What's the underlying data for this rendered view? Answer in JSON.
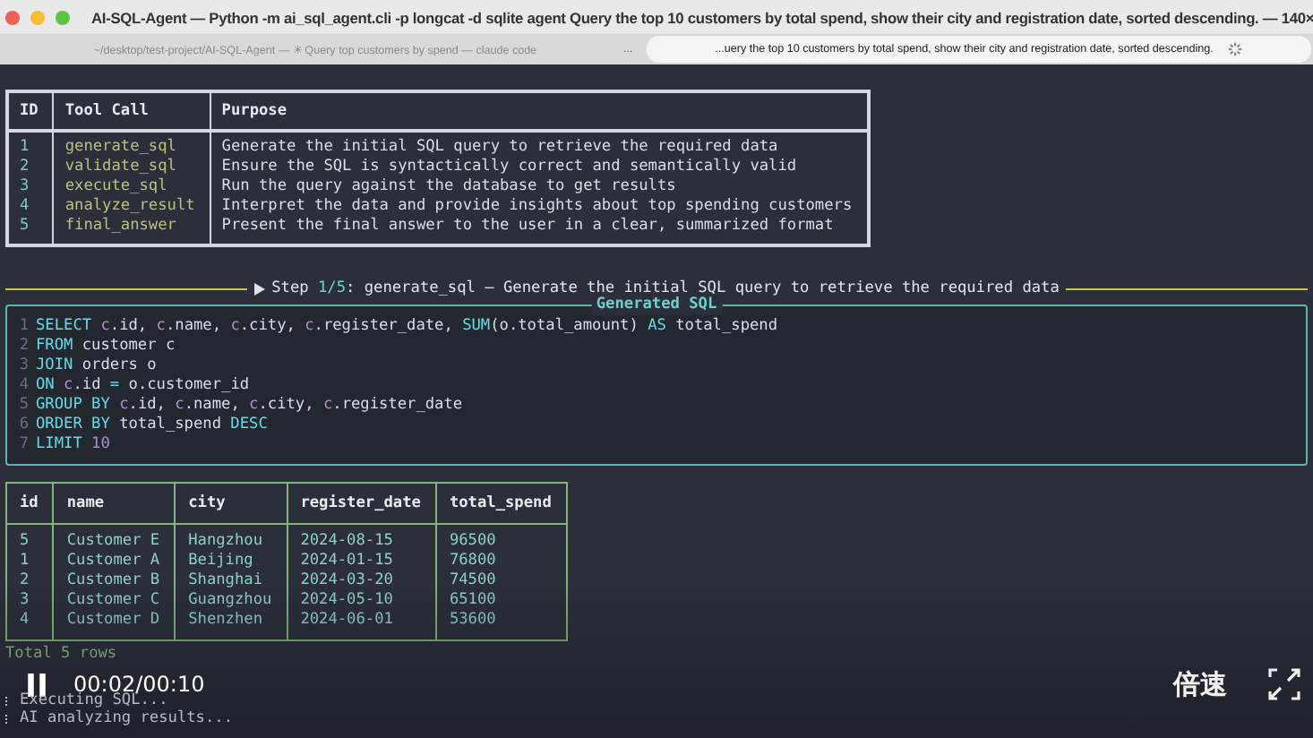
{
  "window": {
    "title": "AI-SQL-Agent — Python -m ai_sql_agent.cli -p longcat -d sqlite agent Query the top 10 customers by total spend, show their city and registration date, sorted descending. — 140×"
  },
  "tabs": [
    {
      "label": "~/desktop/test-project/AI-SQL-Agent — ✳ Query top customers by spend — claude code",
      "selected": false
    },
    {
      "label": "...uery the top 10 customers by total spend, show their city and registration date, sorted descending.",
      "selected": true
    }
  ],
  "tab_overflow": "...",
  "plan_table": {
    "columns": [
      "ID",
      "Tool Call",
      "Purpose"
    ],
    "rows": [
      [
        "1",
        "generate_sql",
        "Generate the initial SQL query to retrieve the required data"
      ],
      [
        "2",
        "validate_sql",
        "Ensure the SQL is syntactically correct and semantically valid"
      ],
      [
        "3",
        "execute_sql",
        "Run the query against the database to get results"
      ],
      [
        "4",
        "analyze_result",
        "Interpret the data and provide insights about top spending customers"
      ],
      [
        "5",
        "final_answer",
        "Present the final answer to the user in a clear, summarized format"
      ]
    ]
  },
  "step": {
    "prefix": "Step ",
    "counter": "1/5",
    "text": ": generate_sql — Generate the initial SQL query to retrieve the required data"
  },
  "sql_panel": {
    "title": "Generated SQL",
    "lines": [
      {
        "number": "1",
        "tokens": [
          {
            "kind": "keyword",
            "text": "SELECT "
          },
          {
            "kind": "alias",
            "text": "c"
          },
          {
            "kind": "plain",
            "text": ".id, "
          },
          {
            "kind": "alias",
            "text": "c"
          },
          {
            "kind": "plain",
            "text": ".name, "
          },
          {
            "kind": "alias",
            "text": "c"
          },
          {
            "kind": "plain",
            "text": ".city, "
          },
          {
            "kind": "alias",
            "text": "c"
          },
          {
            "kind": "plain",
            "text": ".register_date, "
          },
          {
            "kind": "keyword",
            "text": "SUM"
          },
          {
            "kind": "plain",
            "text": "(o.total_amount) "
          },
          {
            "kind": "keyword",
            "text": "AS"
          },
          {
            "kind": "plain",
            "text": " total_spend"
          }
        ]
      },
      {
        "number": "2",
        "tokens": [
          {
            "kind": "keyword",
            "text": "FROM"
          },
          {
            "kind": "plain",
            "text": " customer c"
          }
        ]
      },
      {
        "number": "3",
        "tokens": [
          {
            "kind": "keyword",
            "text": "JOIN"
          },
          {
            "kind": "plain",
            "text": " orders o"
          }
        ]
      },
      {
        "number": "4",
        "tokens": [
          {
            "kind": "keyword",
            "text": "ON "
          },
          {
            "kind": "alias",
            "text": "c"
          },
          {
            "kind": "plain",
            "text": ".id "
          },
          {
            "kind": "keyword",
            "text": "="
          },
          {
            "kind": "plain",
            "text": " o.customer_id"
          }
        ]
      },
      {
        "number": "5",
        "tokens": [
          {
            "kind": "keyword",
            "text": "GROUP BY "
          },
          {
            "kind": "alias",
            "text": "c"
          },
          {
            "kind": "plain",
            "text": ".id, "
          },
          {
            "kind": "alias",
            "text": "c"
          },
          {
            "kind": "plain",
            "text": ".name, "
          },
          {
            "kind": "alias",
            "text": "c"
          },
          {
            "kind": "plain",
            "text": ".city, "
          },
          {
            "kind": "alias",
            "text": "c"
          },
          {
            "kind": "plain",
            "text": ".register_date"
          }
        ]
      },
      {
        "number": "6",
        "tokens": [
          {
            "kind": "keyword",
            "text": "ORDER BY"
          },
          {
            "kind": "plain",
            "text": " total_spend "
          },
          {
            "kind": "keyword",
            "text": "DESC"
          }
        ]
      },
      {
        "number": "7",
        "tokens": [
          {
            "kind": "keyword",
            "text": "LIMIT "
          },
          {
            "kind": "number",
            "text": "10"
          }
        ]
      }
    ]
  },
  "result_table": {
    "columns": [
      "id",
      "name",
      "city",
      "register_date",
      "total_spend"
    ],
    "rows": [
      [
        "5",
        "Customer E",
        "Hangzhou",
        "2024-08-15",
        "96500"
      ],
      [
        "1",
        "Customer A",
        "Beijing",
        "2024-01-15",
        "76800"
      ],
      [
        "2",
        "Customer B",
        "Shanghai",
        "2024-03-20",
        "74500"
      ],
      [
        "3",
        "Customer C",
        "Guangzhou",
        "2024-05-10",
        "65100"
      ],
      [
        "4",
        "Customer D",
        "Shenzhen",
        "2024-06-01",
        "53600"
      ]
    ]
  },
  "log": {
    "summary": "Total 5 rows",
    "steps": [
      "Executing SQL...",
      "AI analyzing results..."
    ]
  },
  "player": {
    "time": "00:02/00:10",
    "speed_button": "倍速"
  }
}
